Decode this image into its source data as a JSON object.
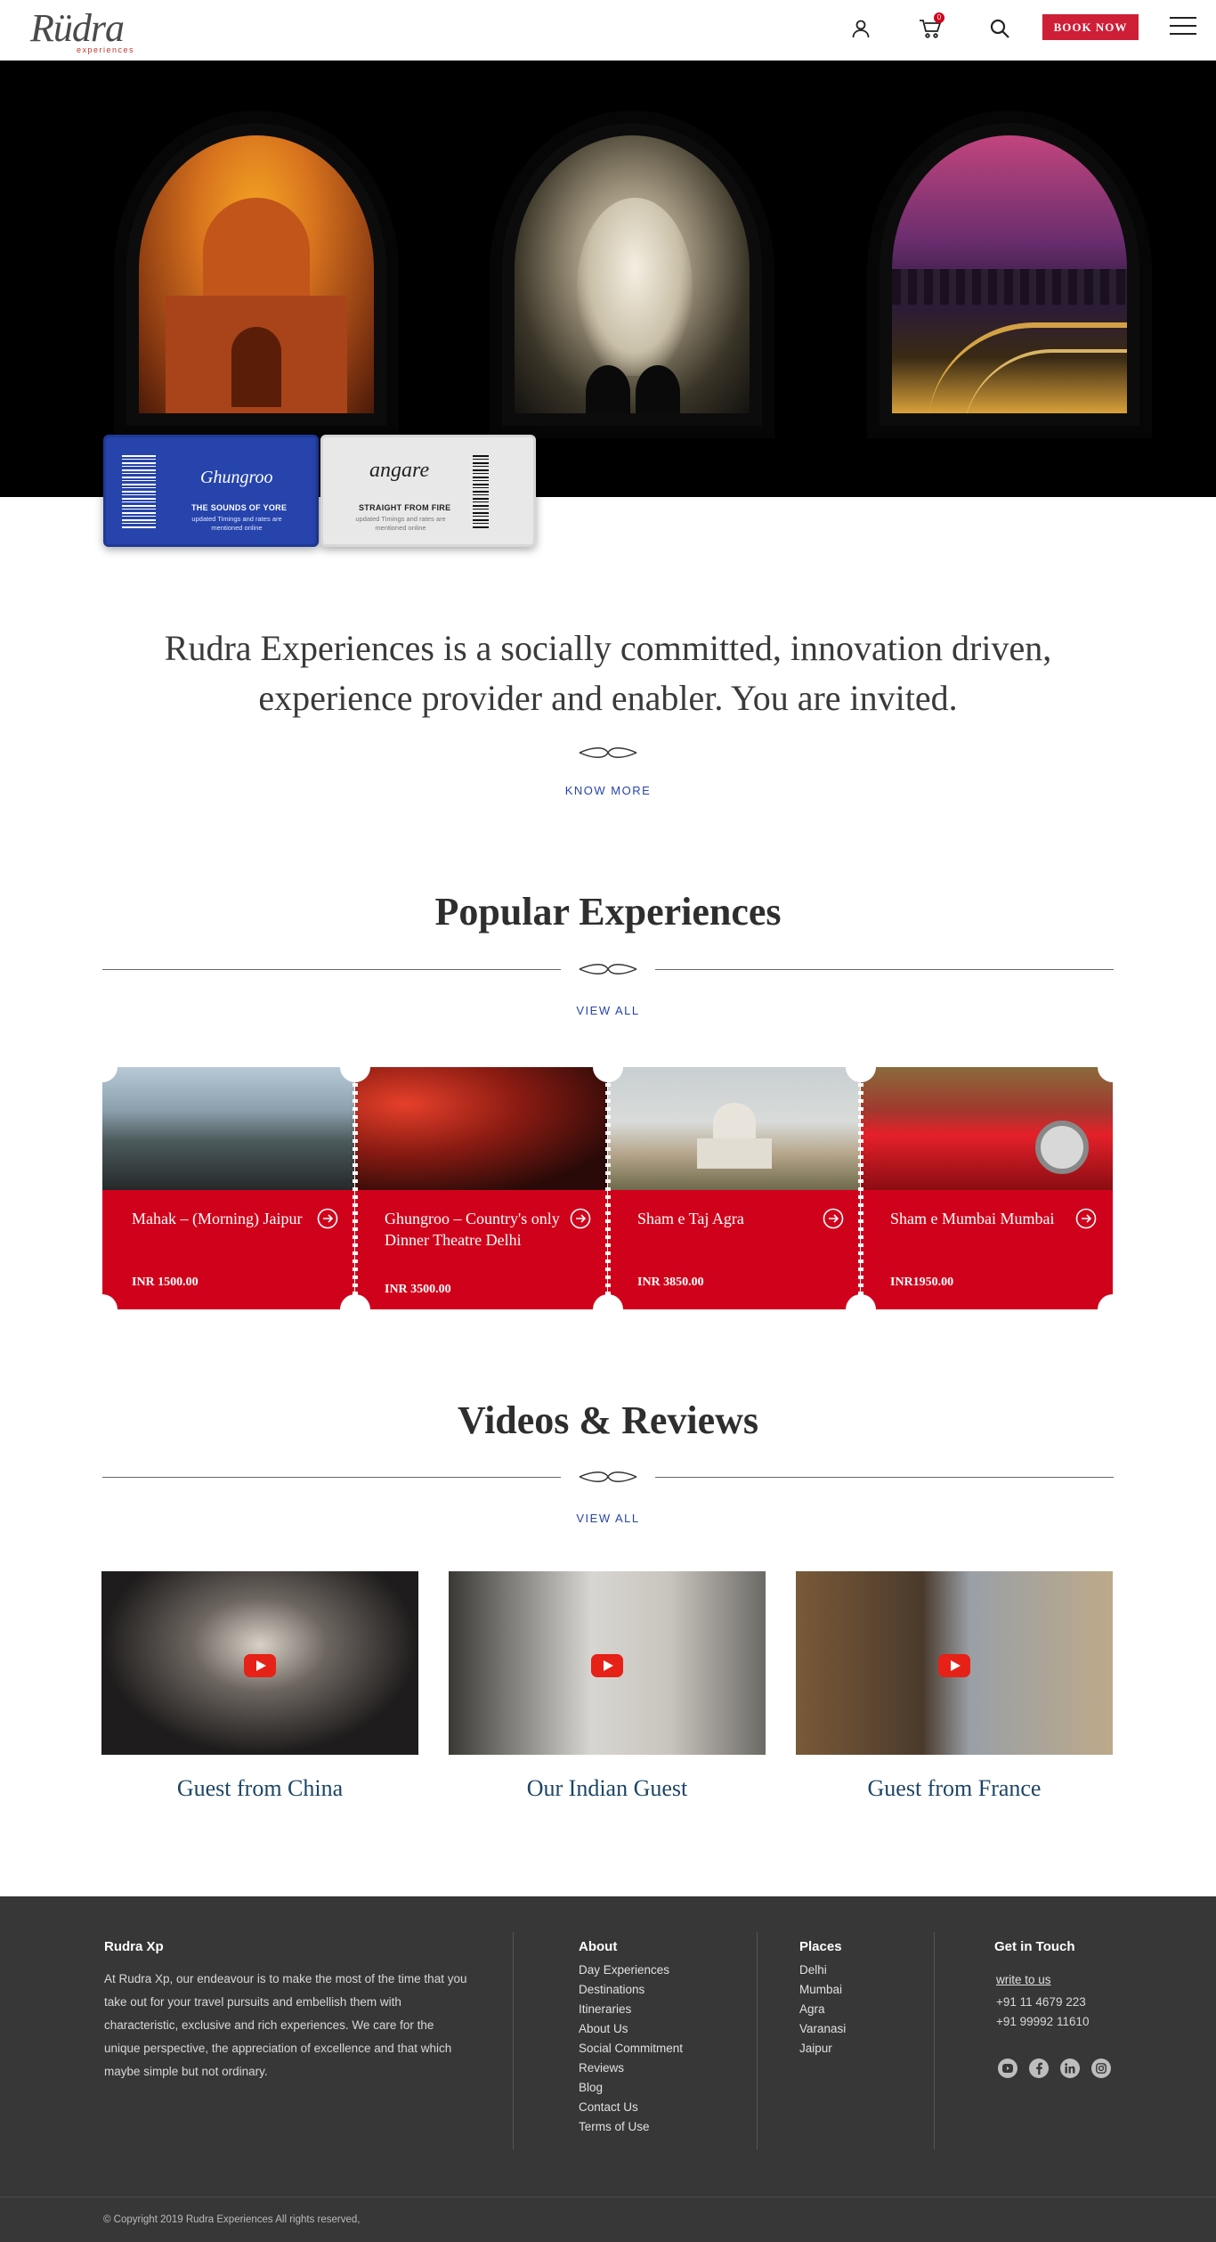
{
  "header": {
    "logo_text": "Rüdra",
    "logo_sub": "experiences",
    "cart_count": "0",
    "book_now_label": "BOOK NOW",
    "icons": [
      "user-icon",
      "cart-icon",
      "search-icon",
      "menu-icon"
    ]
  },
  "tickets": [
    {
      "brand": "Ghungroo",
      "tagline": "THE SOUNDS OF YORE",
      "note": "updated Timings and rates are mentioned online",
      "barcode": "6018120562"
    },
    {
      "brand": "angare",
      "tagline": "STRAIGHT FROM FIRE",
      "note": "updated Timings and rates are mentioned online",
      "barcode": "6018120562"
    }
  ],
  "intro": {
    "statement": "Rudra Experiences is a socially committed, innovation driven, experience provider and enabler. You are invited.",
    "know_more": "KNOW MORE"
  },
  "popular": {
    "title": "Popular Experiences",
    "view_all": "VIEW ALL",
    "items": [
      {
        "title": "Mahak – (Morning) Jaipur",
        "price": "INR 1500.00"
      },
      {
        "title": "Ghungroo – Country's only Dinner Theatre Delhi",
        "price": "INR 3500.00"
      },
      {
        "title": "Sham e Taj Agra",
        "price": "INR 3850.00"
      },
      {
        "title": "Sham e Mumbai Mumbai",
        "price": "INR1950.00"
      }
    ]
  },
  "videos": {
    "title": "Videos & Reviews",
    "view_all": "VIEW ALL",
    "items": [
      {
        "caption": "Guest from China"
      },
      {
        "caption": "Our Indian Guest"
      },
      {
        "caption": "Guest from France"
      }
    ]
  },
  "footer": {
    "about_heading": "Rudra Xp",
    "about_text": "At Rudra Xp, our endeavour is to make the most of the time that you take out for your travel pursuits and embellish them with characteristic, exclusive and rich experiences. We care for the unique perspective, the appreciation of excellence and that which maybe simple but not ordinary.",
    "about_links_heading": "About",
    "about_links": [
      "Day Experiences",
      "Destinations",
      "Itineraries",
      "About Us",
      "Social Commitment",
      "Reviews",
      "Blog",
      "Contact Us",
      "Terms of Use"
    ],
    "places_heading": "Places",
    "places": [
      "Delhi",
      "Mumbai",
      "Agra",
      "Varanasi",
      "Jaipur"
    ],
    "contact_heading": "Get in Touch",
    "write_to_us": "write to us",
    "phone_1": "+91 11 4679 223",
    "phone_2": "+91 99992 11610",
    "social_icons": [
      "youtube-icon",
      "facebook-icon",
      "linkedin-icon",
      "instagram-icon"
    ],
    "copyright": "© Copyright 2019 Rudra Experiences All rights reserved,"
  },
  "colors": {
    "accent_red": "#d0021b",
    "link_blue": "#2644ab",
    "footer_bg": "#373737",
    "caption_blue": "#1c4566"
  }
}
